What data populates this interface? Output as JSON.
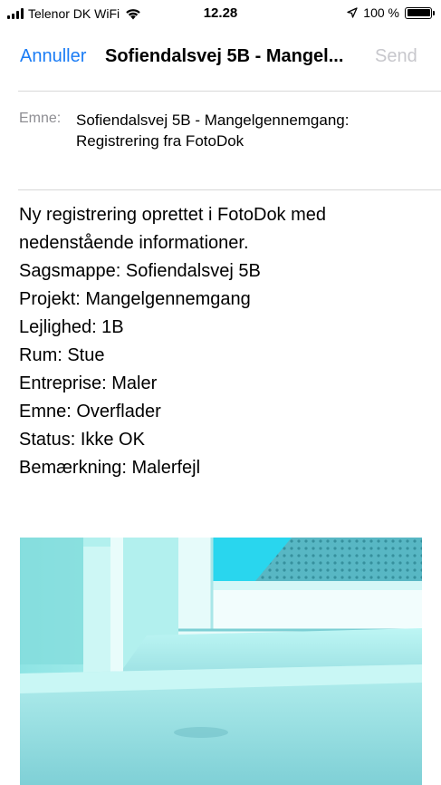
{
  "status_bar": {
    "carrier": "Telenor DK WiFi",
    "time": "12.28",
    "battery": "100 %"
  },
  "nav": {
    "cancel_label": "Annuller",
    "title": "Sofiendalsvej 5B - Mangel...",
    "send_label": "Send"
  },
  "subject": {
    "label": "Emne:",
    "value": "Sofiendalsvej 5B - Mangelgennemgang: Registrering fra FotoDok"
  },
  "body": {
    "intro_line1": "Ny registrering oprettet i FotoDok med",
    "intro_line2": "nedenstående informationer.",
    "sagsmappe": "Sagsmappe: Sofiendalsvej 5B",
    "projekt": "Projekt: Mangelgennemgang",
    "lejlighed": "Lejlighed: 1B",
    "rum": "Rum: Stue",
    "entreprise": "Entreprise: Maler",
    "emne": "Emne: Overflader",
    "status": "Status: Ikke OK",
    "bemaerkning": "Bemærkning: Malerfejl"
  },
  "colors": {
    "accent": "#1a7cf5",
    "disabled": "#c7c7cc",
    "label_gray": "#8e8e93"
  }
}
